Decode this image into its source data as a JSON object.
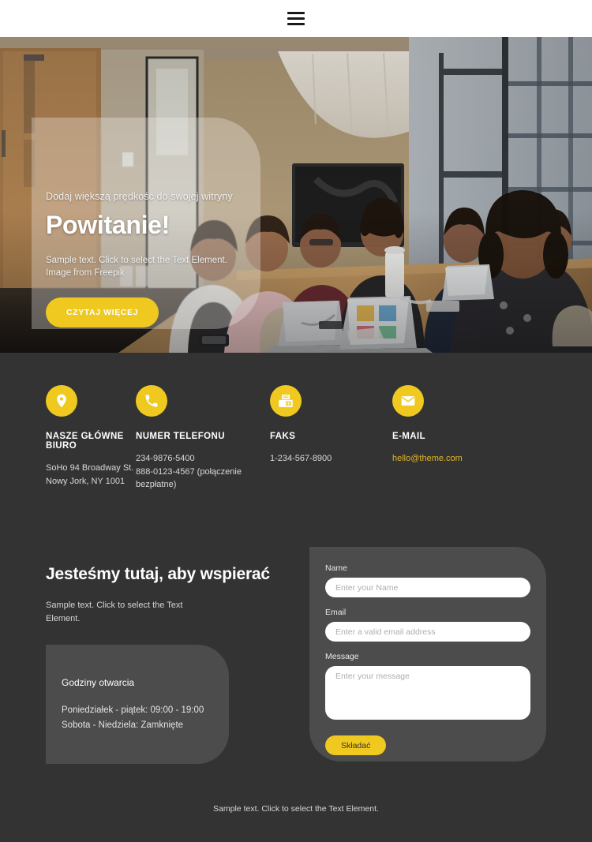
{
  "header": {
    "menu_icon": "hamburger-icon"
  },
  "hero": {
    "eyebrow": "Dodaj większą prędkość do swojej witryny",
    "title": "Powitanie!",
    "subtitle_line1": "Sample text. Click to select the Text Element.",
    "subtitle_line2": "Image from Freepik",
    "cta_label": "CZYTAJ WIĘCEJ",
    "image_description": "Business team meeting around conference table with laptops"
  },
  "contact": {
    "items": [
      {
        "icon": "location-pin-icon",
        "title": "NASZE GŁÓWNE BIURO",
        "line1": "SoHo 94 Broadway St.",
        "line2": "Nowy Jork, NY 1001",
        "line3": "",
        "accent": false
      },
      {
        "icon": "phone-icon",
        "title": "NUMER TELEFONU",
        "line1": "234-9876-5400",
        "line2": "888-0123-4567 (połączenie",
        "line3": "bezpłatne)",
        "accent": false
      },
      {
        "icon": "fax-icon",
        "title": "FAKS",
        "line1": "1-234-567-8900",
        "line2": "",
        "line3": "",
        "accent": false
      },
      {
        "icon": "envelope-icon",
        "title": "E-MAIL",
        "line1": "hello@theme.com",
        "line2": "",
        "line3": "",
        "accent": true
      }
    ]
  },
  "support": {
    "heading": "Jesteśmy tutaj, aby wspierać",
    "sub_line1": "Sample text. Click to select the Text",
    "sub_line2": "Element.",
    "hours": {
      "title": "Godziny otwarcia",
      "line1": "Poniedziałek - piątek: 09:00 - 19:00",
      "line2": "Sobota - Niedziela: Zamknięte"
    }
  },
  "form": {
    "name_label": "Name",
    "name_placeholder": "Enter your Name",
    "email_label": "Email",
    "email_placeholder": "Enter a valid email address",
    "message_label": "Message",
    "message_placeholder": "Enter your message",
    "submit_label": "Składać"
  },
  "footer": {
    "text": "Sample text. Click to select the Text Element."
  },
  "colors": {
    "accent": "#efc91f",
    "page_background": "#333333",
    "panel_background": "#4c4c4c",
    "email_link": "#e0b528"
  }
}
